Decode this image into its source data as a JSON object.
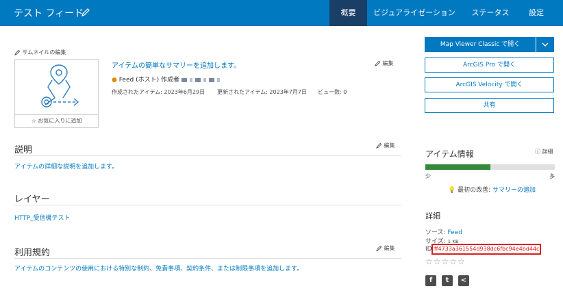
{
  "header": {
    "title": "テスト フィード",
    "tabs": [
      {
        "label": "概要",
        "active": true
      },
      {
        "label": "ビジュアライゼーション",
        "active": false
      },
      {
        "label": "ステータス",
        "active": false
      },
      {
        "label": "設定",
        "active": false
      }
    ]
  },
  "thumbnail": {
    "edit_label": "サムネイルの編集",
    "favorite_label": "お気に入りに追加"
  },
  "summary": {
    "add_summary": "アイテムの簡単なサマリーを追加します。",
    "edit_label": "編集",
    "type_owner": "Feed (ホスト) 作成者",
    "created": "作成されたアイテム: 2023年6月29日",
    "updated": "更新されたアイテム: 2023年7月7日",
    "views": "ビュー数: 0"
  },
  "description": {
    "title": "説明",
    "edit_label": "編集",
    "text": "アイテムの詳細な説明を追加します。"
  },
  "layers": {
    "title": "レイヤー",
    "item": "HTTP_受信機テスト"
  },
  "terms": {
    "title": "利用規約",
    "edit_label": "編集",
    "text": "アイテムのコンテンツの使用における特別な制約、免責事項、契約条件、または制限事項を追加します。"
  },
  "actions": {
    "open_map_viewer": "Map Viewer Classic で開く",
    "open_pro": "ArcGIS Pro で開く",
    "open_velocity": "ArcGIS Velocity で開く",
    "share": "共有"
  },
  "item_info": {
    "title": "アイテム情報",
    "help": "詳細",
    "progress": 0.5,
    "low": "少",
    "high": "多",
    "tip_prefix": "最初の改善:",
    "tip_link": "サマリーの追加"
  },
  "details": {
    "title": "詳細",
    "source_label": "ソース:",
    "source_value": "Feed",
    "size_label": "サイズ:",
    "size_value": "1 KB",
    "id_label": "ID:",
    "id_value": "ff4733a361554d938dc6fbc94e4bd44c",
    "rating": "☆☆☆☆☆"
  },
  "colors": {
    "brand": "#0079c1",
    "nav_active": "#1a3f66",
    "progress": "#34893a",
    "highlight": "#d9201f"
  }
}
